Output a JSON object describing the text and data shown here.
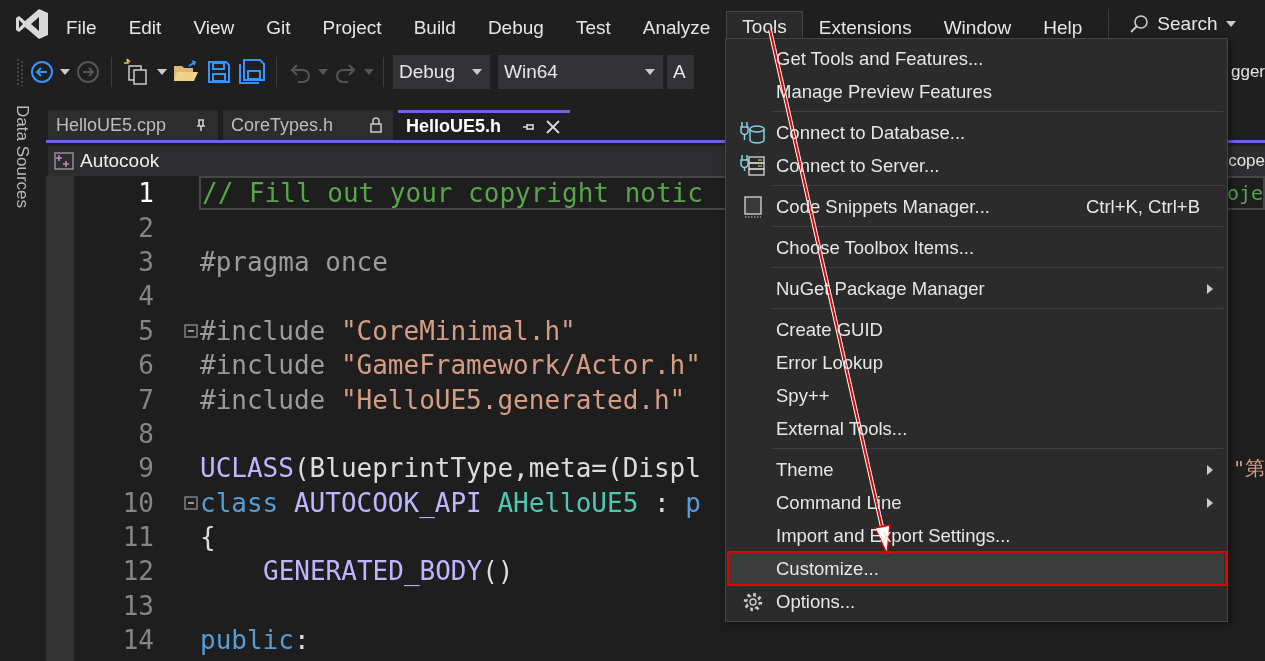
{
  "menu_bar": {
    "items": [
      {
        "label": "File",
        "selected": false
      },
      {
        "label": "Edit",
        "selected": false
      },
      {
        "label": "View",
        "selected": false
      },
      {
        "label": "Git",
        "selected": false
      },
      {
        "label": "Project",
        "selected": false
      },
      {
        "label": "Build",
        "selected": false
      },
      {
        "label": "Debug",
        "selected": false
      },
      {
        "label": "Test",
        "selected": false
      },
      {
        "label": "Analyze",
        "selected": false
      },
      {
        "label": "Tools",
        "selected": true
      },
      {
        "label": "Extensions",
        "selected": false
      },
      {
        "label": "Window",
        "selected": false
      },
      {
        "label": "Help",
        "selected": false
      }
    ],
    "search": {
      "label": "Search"
    }
  },
  "toolbar": {
    "dropdowns": [
      {
        "value": "Debug"
      },
      {
        "value": "Win64"
      },
      {
        "value": "A"
      }
    ],
    "trailing_text": "gger"
  },
  "side_panel_tab": {
    "label": "Data Sources"
  },
  "tabs": [
    {
      "label": "HelloUE5.cpp",
      "selected": false,
      "pinned": true,
      "locked": false
    },
    {
      "label": "CoreTypes.h",
      "selected": false,
      "pinned": false,
      "locked": true
    },
    {
      "label": "HelloUE5.h",
      "selected": true,
      "pinned": false,
      "locked": false
    }
  ],
  "navigation_bar": {
    "project": "Autocook",
    "trailing_text": "cope"
  },
  "editor": {
    "lines": [
      {
        "number": "1",
        "current": true,
        "fold": false,
        "segments": [
          {
            "kind": "comment",
            "text": "// Fill out your copyright notic"
          }
        ],
        "right_fragment": {
          "kind": "comment",
          "text": "oje"
        }
      },
      {
        "number": "2",
        "current": false,
        "fold": false
      },
      {
        "number": "3",
        "current": false,
        "fold": false,
        "segments": [
          {
            "kind": "preprocessor",
            "text": "#pragma once"
          }
        ]
      },
      {
        "number": "4",
        "current": false,
        "fold": false
      },
      {
        "number": "5",
        "current": false,
        "fold": true,
        "segments": [
          {
            "kind": "preprocessor",
            "text": "#include "
          },
          {
            "kind": "string",
            "text": "\"CoreMinimal.h\""
          }
        ]
      },
      {
        "number": "6",
        "current": false,
        "fold": false,
        "segments": [
          {
            "kind": "preprocessor",
            "text": "#include "
          },
          {
            "kind": "string",
            "text": "\"GameFramework/Actor.h\""
          }
        ]
      },
      {
        "number": "7",
        "current": false,
        "fold": false,
        "segments": [
          {
            "kind": "preprocessor",
            "text": "#include "
          },
          {
            "kind": "string",
            "text": "\"HelloUE5.generated.h\""
          }
        ]
      },
      {
        "number": "8",
        "current": false,
        "fold": false
      },
      {
        "number": "9",
        "current": false,
        "fold": false,
        "segments": [
          {
            "kind": "macro",
            "text": "UCLASS"
          },
          {
            "kind": "plain",
            "text": "(BlueprintType,meta=(Displ"
          }
        ],
        "right_fragment": {
          "kind": "string",
          "text": "\"第"
        }
      },
      {
        "number": "10",
        "current": false,
        "fold": true,
        "segments": [
          {
            "kind": "keyword",
            "text": "class "
          },
          {
            "kind": "macro",
            "text": "AUTOCOOK_API "
          },
          {
            "kind": "type",
            "text": "AHelloUE5"
          },
          {
            "kind": "plain",
            "text": " : "
          },
          {
            "kind": "keyword",
            "text": "p"
          }
        ]
      },
      {
        "number": "11",
        "current": false,
        "fold": false,
        "segments": [
          {
            "kind": "plain",
            "text": "{"
          }
        ]
      },
      {
        "number": "12",
        "current": false,
        "fold": false,
        "indented": true,
        "segments": [
          {
            "kind": "macro",
            "text": "GENERATED_BODY"
          },
          {
            "kind": "plain",
            "text": "()"
          }
        ]
      },
      {
        "number": "13",
        "current": false,
        "fold": false
      },
      {
        "number": "14",
        "current": false,
        "fold": false,
        "segments": [
          {
            "kind": "keyword",
            "text": "public"
          },
          {
            "kind": "plain",
            "text": ":"
          }
        ]
      }
    ]
  },
  "tools_menu": {
    "items": [
      {
        "kind": "item",
        "label": "Get Tools and Features...",
        "selected": false
      },
      {
        "kind": "item",
        "label": "Manage Preview Features",
        "selected": false
      },
      {
        "kind": "separator"
      },
      {
        "kind": "item",
        "label": "Connect to Database...",
        "selected": false
      },
      {
        "kind": "item",
        "label": "Connect to Server...",
        "selected": false
      },
      {
        "kind": "separator"
      },
      {
        "kind": "item",
        "label": "Code Snippets Manager...",
        "shortcut": "Ctrl+K, Ctrl+B",
        "selected": false
      },
      {
        "kind": "separator"
      },
      {
        "kind": "item",
        "label": "Choose Toolbox Items...",
        "selected": false
      },
      {
        "kind": "separator"
      },
      {
        "kind": "item",
        "label": "NuGet Package Manager",
        "submenu": true,
        "selected": false
      },
      {
        "kind": "separator"
      },
      {
        "kind": "item",
        "label": "Create GUID",
        "selected": false
      },
      {
        "kind": "item",
        "label": "Error Lookup",
        "selected": false
      },
      {
        "kind": "item",
        "label": "Spy++",
        "selected": false
      },
      {
        "kind": "item",
        "label": "External Tools...",
        "selected": false
      },
      {
        "kind": "separator"
      },
      {
        "kind": "item",
        "label": "Theme",
        "submenu": true,
        "selected": false
      },
      {
        "kind": "item",
        "label": "Command Line",
        "submenu": true,
        "selected": false
      },
      {
        "kind": "item",
        "label": "Import and Export Settings...",
        "selected": false
      },
      {
        "kind": "item",
        "label": "Customize...",
        "selected": true,
        "annotated": true
      },
      {
        "kind": "item",
        "label": "Options...",
        "selected": false
      }
    ]
  },
  "annotation_arrow": true
}
